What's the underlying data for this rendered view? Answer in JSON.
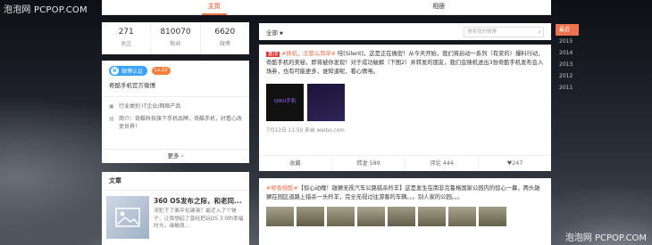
{
  "watermark_left": "泡泡网 PCPOP.COM",
  "watermark_right": "泡泡网 PCPOP.COM",
  "tabs": [
    {
      "label": "主页",
      "active": true
    },
    {
      "label": "相册",
      "active": false
    }
  ],
  "counts": [
    {
      "value": "271",
      "label": "关注"
    },
    {
      "value": "810070",
      "label": "粉丝"
    },
    {
      "value": "6620",
      "label": "微博"
    }
  ],
  "about": {
    "verify_label": "微博认证",
    "level": "Lv.22",
    "official": "奇酷手机官方微博",
    "industry": "行业类别 IT企业/网络产品",
    "intro": "简介：奇酷科技旗下手机品牌，奇酷手机，好看心改变世界！",
    "more": "更多"
  },
  "articles": {
    "title": "文章",
    "item_title": "360 OS发布之际，和老同...",
    "item_desc": "流犯下了离平化键演？最近入了个锤子，让我想起了曾经把玩OS 3.0的率福时光，谁触良..."
  },
  "filter": {
    "all_label": "全部",
    "search_placeholder": "搜索我的微博"
  },
  "post1": {
    "tag": "置顶",
    "hashtag": "#换机，没那么简单#",
    "text": " 哇[Silent]，这是正在做密！从今天开始，我们将启动一系列（有奖的）爆料行动，奇酷手机的美秘，即将被你发现！对于成功破解（下图2）并转发的朋友，我们会随机送出3张奇酷手机发布会入场券，也有可能更多，谁知道呢，看心情咯。",
    "image1_text": "QIKU手机",
    "meta": "7月13日 11:50 来自 weibo.com",
    "actions": [
      "收藏",
      "转发 589",
      "评论 444",
      "♥247"
    ]
  },
  "post2": {
    "hashtag": "#够香够酷#",
    "text": "【惊心动魄！雄狮无视汽车公路猎杀羚羊】这是发生在南非克鲁格国家公园内的惊心一幕，两头雄狮在园区道路上猎杀一头羚羊，完全无视过往游客的车辆。。。别人家的公园。。。"
  },
  "years": [
    {
      "label": "最近",
      "active": true
    },
    {
      "label": "2015",
      "active": false
    },
    {
      "label": "2014",
      "active": false
    },
    {
      "label": "2013",
      "active": false
    },
    {
      "label": "2012",
      "active": false
    },
    {
      "label": "2011",
      "active": false
    }
  ]
}
